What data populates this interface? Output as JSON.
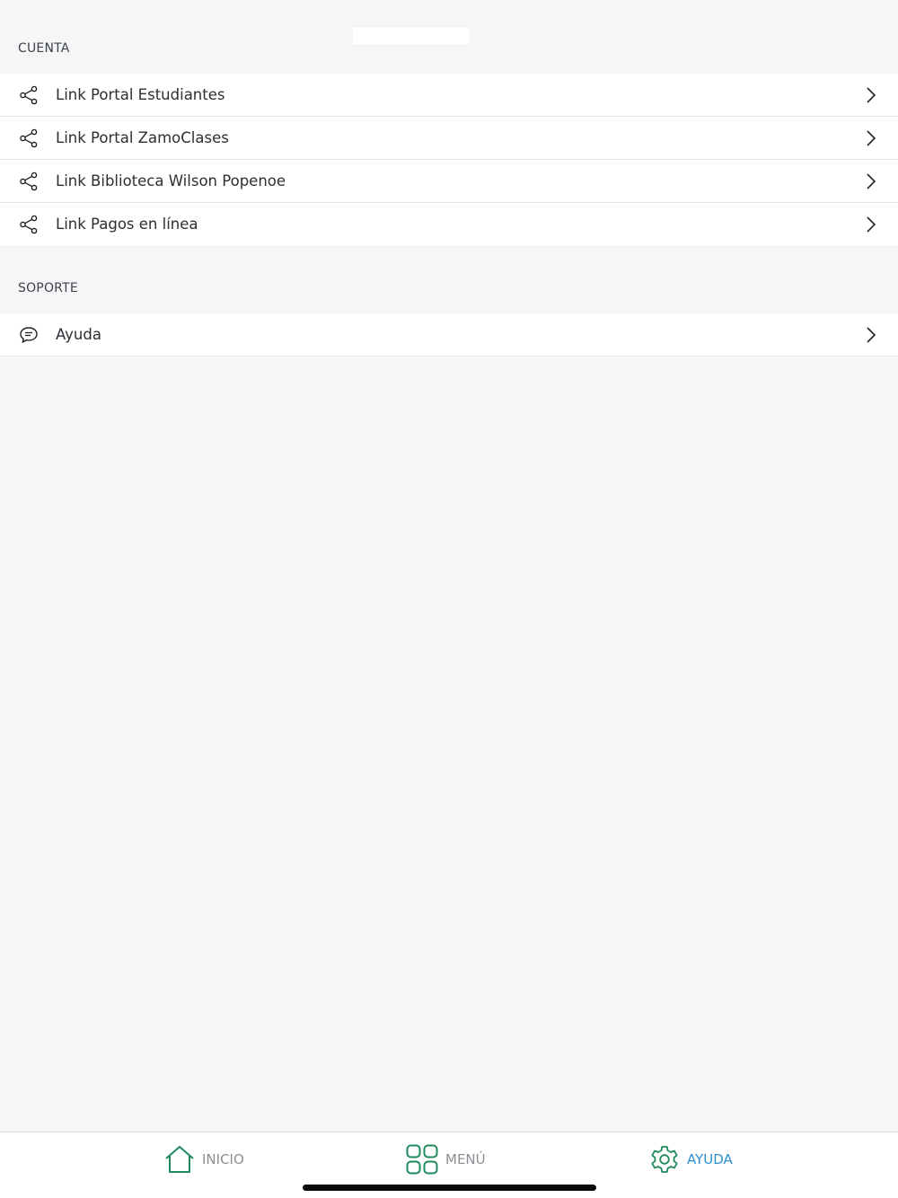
{
  "sections": {
    "cuenta": {
      "header": "CUENTA",
      "items": [
        {
          "label": "Link Portal Estudiantes",
          "icon": "share-icon"
        },
        {
          "label": "Link Portal ZamoClases",
          "icon": "share-icon"
        },
        {
          "label": "Link Biblioteca Wilson Popenoe",
          "icon": "share-icon"
        },
        {
          "label": "Link Pagos en línea",
          "icon": "share-icon"
        }
      ]
    },
    "soporte": {
      "header": "SOPORTE",
      "items": [
        {
          "label": "Ayuda",
          "icon": "chat-bubble-icon"
        }
      ]
    }
  },
  "tabbar": {
    "tabs": [
      {
        "label": "INICIO",
        "icon": "home-icon",
        "active": false
      },
      {
        "label": "MENÚ",
        "icon": "grid-icon",
        "active": false
      },
      {
        "label": "AYUDA",
        "icon": "gear-icon",
        "active": true
      }
    ]
  },
  "colors": {
    "background": "#f5f6f8",
    "icon_green": "#1f8a5c",
    "active_tab_text": "#2f8fd0",
    "inactive_tab_text": "#8b8f93"
  }
}
